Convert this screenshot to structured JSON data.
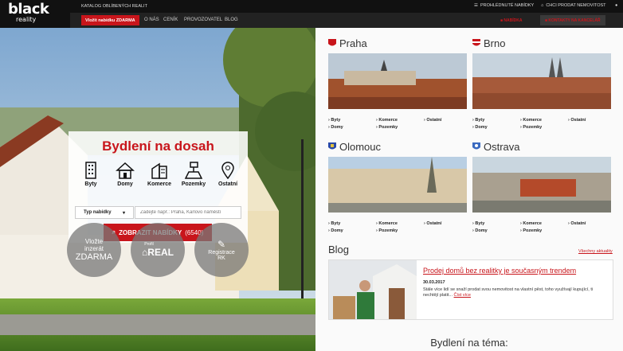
{
  "brand": {
    "name": "black",
    "sub": "reality"
  },
  "topbar": {
    "katalog": "KATALOG OBLÍBENÝCH REALIT",
    "browse": "PROHLÉDNUTÉ NABÍDKY",
    "sell": "CHCI PRODAT NEMOVITOST"
  },
  "nav": {
    "cta": "Vložit nabídku ZDARMA",
    "links": [
      "O NÁS",
      "CENÍK",
      "PROVOZOVATEL",
      "BLOG"
    ],
    "offer": "NABÍDKA",
    "contact": "KONTAKTY NA KANCELÁŘ"
  },
  "search": {
    "title": "Bydlení na dosah",
    "categories": [
      {
        "label": "Byty",
        "icon": "apartment-icon"
      },
      {
        "label": "Domy",
        "icon": "house-icon"
      },
      {
        "label": "Komerce",
        "icon": "commercial-icon"
      },
      {
        "label": "Pozemky",
        "icon": "land-icon"
      },
      {
        "label": "Ostatní",
        "icon": "location-pin-icon"
      }
    ],
    "type_label": "Typ nabídky",
    "placeholder": "Zadejte např.: Praha, Karlovo náměstí",
    "button": "ZOBRAZIT NABÍDKY",
    "count": "(6540)"
  },
  "circles": {
    "c1": [
      "Vložte",
      "inzerát",
      "ZDARMA"
    ],
    "c2": [
      "Profil",
      "REAL"
    ],
    "c3": [
      "Registrace",
      "RK"
    ]
  },
  "cities": [
    {
      "name": "Praha",
      "links": [
        "Byty",
        "Komerce",
        "Ostatní",
        "Domy",
        "Pozemky"
      ]
    },
    {
      "name": "Brno",
      "links": [
        "Byty",
        "Komerce",
        "Ostatní",
        "Domy",
        "Pozemky"
      ]
    },
    {
      "name": "Olomouc",
      "links": [
        "Byty",
        "Komerce",
        "Ostatní",
        "Domy",
        "Pozemky"
      ]
    },
    {
      "name": "Ostrava",
      "links": [
        "Byty",
        "Komerce",
        "Ostatní",
        "Domy",
        "Pozemky"
      ]
    }
  ],
  "blog": {
    "heading": "Blog",
    "all": "Všechny aktuality",
    "post_title": "Prodej domů bez realitky je současným trendem",
    "date": "30.03.2017",
    "text": "Stále více lidí se snaží prodat svou nemovitost na vlastní pěst, toho využívají kupující, ti nechtějí platit...",
    "more": "Číst více"
  },
  "theme": "Bydlení na téma:",
  "colors": {
    "accent": "#c8151b",
    "dark": "#111111"
  }
}
